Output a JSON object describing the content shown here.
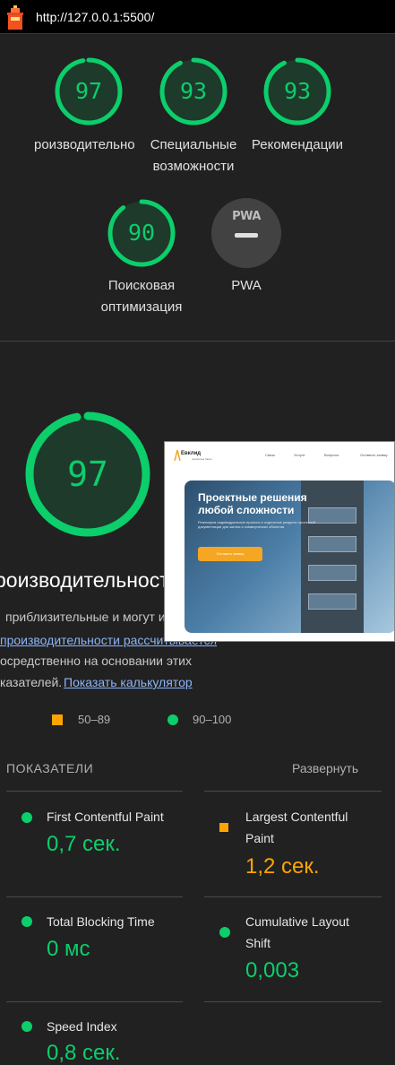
{
  "browser": {
    "url": "http://127.0.0.1:5500/",
    "logo_icon": "lighthouse-icon"
  },
  "summary": {
    "performance": {
      "score": "97",
      "label_line1": "роизводительно"
    },
    "accessibility": {
      "score": "93",
      "label_line1": "Специальные",
      "label_line2": "возможности"
    },
    "best_practices": {
      "score": "93",
      "label_line1": "Рекомендации"
    },
    "seo": {
      "score": "90",
      "label_line1": "Поисковая",
      "label_line2": "оптимизация"
    },
    "pwa": {
      "badge": "PWA",
      "label": "PWA"
    }
  },
  "performance_detail": {
    "score": "97",
    "title": "роизводительность",
    "desc_line1": "приблизительные и могут и",
    "desc_link1": "производительности рассчитывается",
    "desc_line3": "осредственно на основании этих",
    "desc_line4": "казателей.",
    "desc_link2": "Показать калькулятор"
  },
  "preview": {
    "brand": "Евклид",
    "brand_sub": "проектное бюро",
    "nav": [
      "Связь",
      "Услуги",
      "Вопросы",
      "Оставить заявку"
    ],
    "hero_title_line1": "Проектные решения",
    "hero_title_line2": "любой сложности",
    "hero_sub": "Реализуем индивидуальные проекты и отдельные разделы проектной документации для жилых и коммерческих объектов",
    "cta": "Оставить заявку"
  },
  "legend": {
    "average": "50–89",
    "good": "90–100"
  },
  "metrics": {
    "title": "ПОКАЗАТЕЛИ",
    "expand": "Развернуть",
    "fcp": {
      "line1": "First Contentful Paint",
      "value": "0,7 сек."
    },
    "lcp": {
      "line1": "Largest Contentful",
      "line2": "Paint",
      "value": "1,2 сек."
    },
    "tbt": {
      "line1": "Total Blocking Time",
      "value": "0 мс"
    },
    "cls": {
      "line1": "Cumulative Layout",
      "line2": "Shift",
      "value": "0,003"
    },
    "si": {
      "line1": "Speed Index",
      "value": "0,8 сек."
    }
  },
  "colors": {
    "good": "#0cce6b",
    "average": "#ffa400",
    "background": "#212121"
  }
}
